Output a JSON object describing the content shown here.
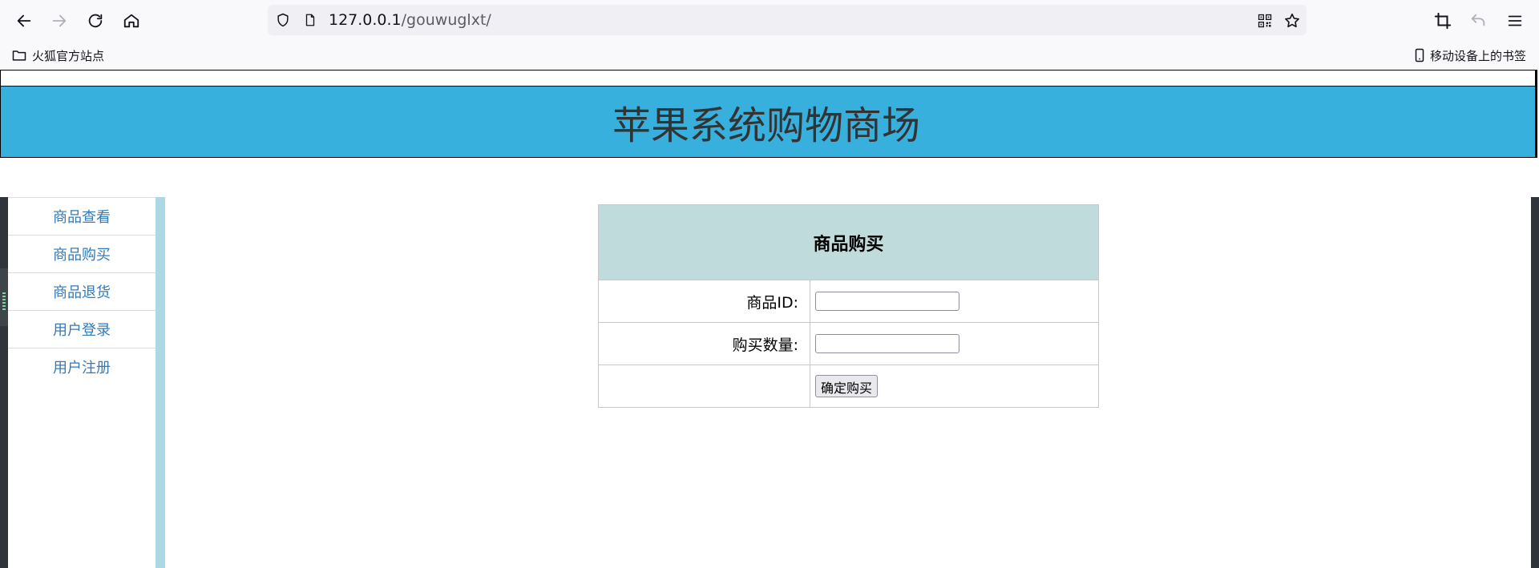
{
  "browser": {
    "url_host": "127.0.0.1",
    "url_path": "/gouwuglxt/",
    "bookmark_folder": "火狐官方站点",
    "mobile_bookmarks": "移动设备上的书签"
  },
  "header": {
    "title": "苹果系统购物商场"
  },
  "sidebar": {
    "items": [
      {
        "label": "商品查看"
      },
      {
        "label": "商品购买"
      },
      {
        "label": "商品退货"
      },
      {
        "label": "用户登录"
      },
      {
        "label": "用户注册"
      }
    ]
  },
  "form": {
    "heading": "商品购买",
    "product_id_label": "商品ID:",
    "quantity_label": "购买数量:",
    "submit_label": "确定购买",
    "product_id_value": "",
    "quantity_value": ""
  },
  "colors": {
    "banner": "#38b0de",
    "sidebar_border": "#add8e6",
    "table_header": "#c0dbdb",
    "link": "#337ab7"
  }
}
